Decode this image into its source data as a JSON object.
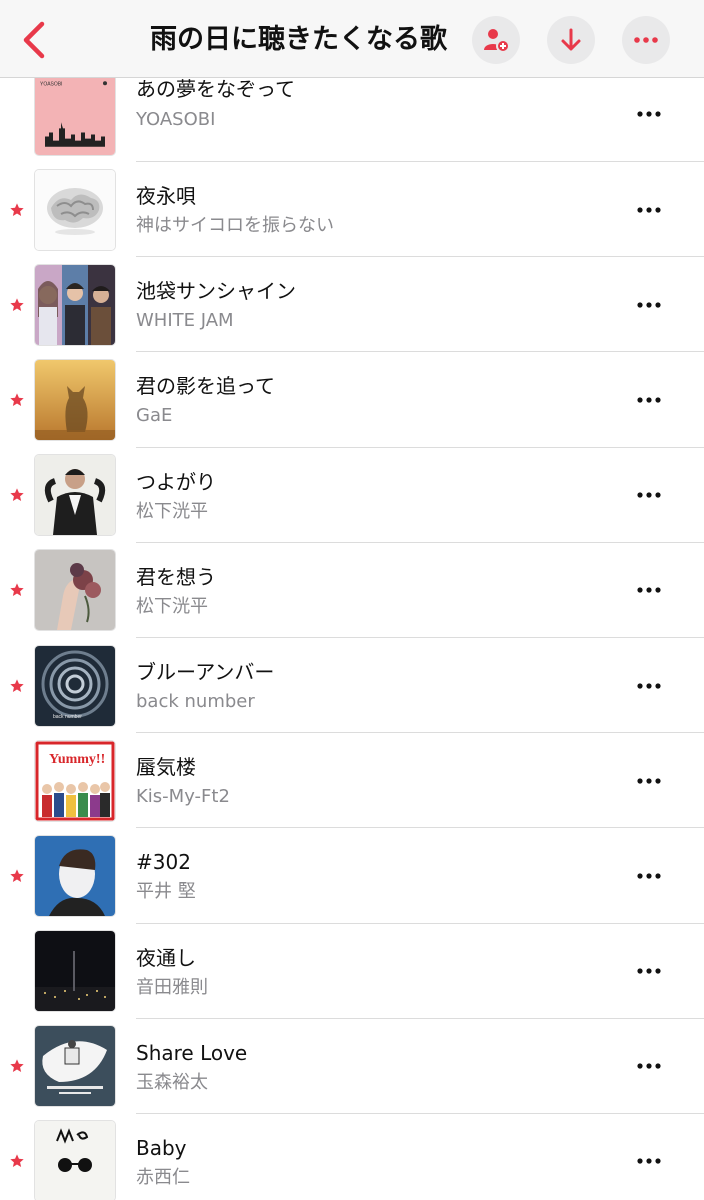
{
  "header": {
    "title": "雨の日に聴きたくなる歌",
    "back_icon": "chevron-left-icon",
    "buttons": [
      "add-collaborator-icon",
      "download-icon",
      "more-icon"
    ],
    "accent_color": "#e8394a"
  },
  "songs": [
    {
      "title": "あの夢をなぞって",
      "artist": "YOASOBI",
      "favorite": false,
      "artwork": "artwork-pink-cityscape"
    },
    {
      "title": "夜永唄",
      "artist": "神はサイコロを振らない",
      "favorite": true,
      "artwork": "artwork-white-brain"
    },
    {
      "title": "池袋サンシャイン",
      "artist": "WHITE JAM",
      "favorite": true,
      "artwork": "artwork-band-photo"
    },
    {
      "title": "君の影を追って",
      "artist": "GaE",
      "favorite": true,
      "artwork": "artwork-golden-cat"
    },
    {
      "title": "つよがり",
      "artist": "松下洸平",
      "favorite": true,
      "artwork": "artwork-portrait-man"
    },
    {
      "title": "君を想う",
      "artist": "松下洸平",
      "favorite": true,
      "artwork": "artwork-flowers-hand"
    },
    {
      "title": "ブルーアンバー",
      "artist": "back number",
      "favorite": true,
      "artwork": "artwork-spiral-staircase"
    },
    {
      "title": "蜃気楼",
      "artist": "Kis-My-Ft2",
      "favorite": false,
      "artwork": "artwork-yummy-group"
    },
    {
      "title": "#302",
      "artist": "平井 堅",
      "favorite": true,
      "artwork": "artwork-blue-portrait"
    },
    {
      "title": "夜通し",
      "artist": "音田雅則",
      "favorite": false,
      "artwork": "artwork-night-city"
    },
    {
      "title": "Share Love",
      "artist": "玉森裕太",
      "favorite": true,
      "artwork": "artwork-10th-anniversary"
    },
    {
      "title": "Baby",
      "artist": "赤西仁",
      "favorite": true,
      "artwork": "artwork-me-sunglasses"
    }
  ]
}
